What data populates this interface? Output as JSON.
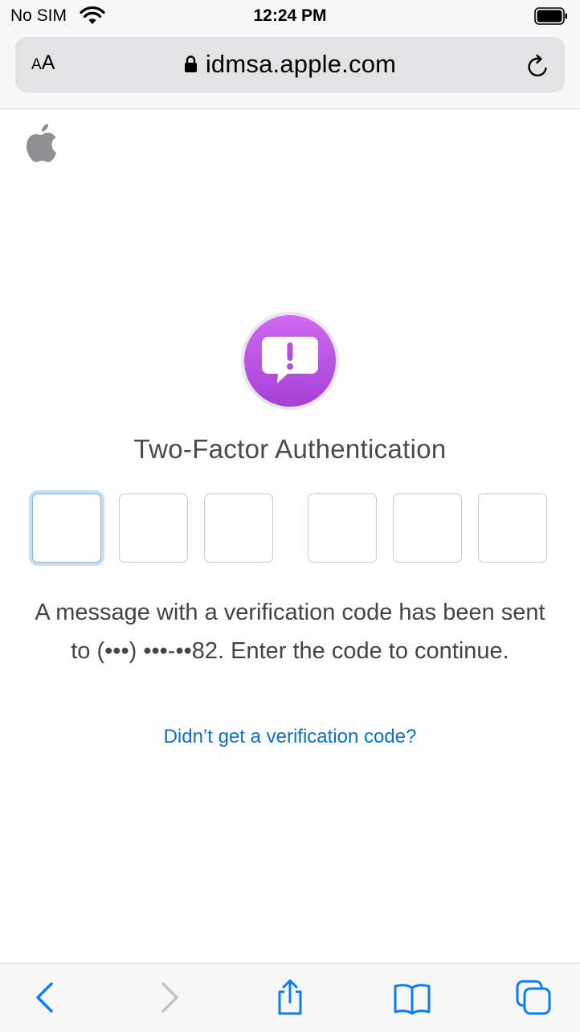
{
  "status_bar": {
    "carrier": "No SIM",
    "time": "12:24 PM"
  },
  "browser": {
    "text_size_small": "A",
    "text_size_large": "A",
    "url": "idmsa.apple.com"
  },
  "page": {
    "title": "Two-Factor Authentication",
    "code_digits": [
      "",
      "",
      "",
      "",
      "",
      ""
    ],
    "message": "A message with a verification code has been sent to (•••) •••-••82. Enter the code to continue.",
    "help_link": "Didn’t get a verification code?"
  },
  "icons": {
    "status": [
      "wifi-icon",
      "battery-icon"
    ],
    "address_bar": [
      "lock-icon",
      "reload-icon"
    ],
    "page": [
      "apple-logo-icon",
      "alert-message-icon"
    ],
    "toolbar": [
      "back-icon",
      "forward-icon",
      "share-icon",
      "bookmarks-icon",
      "tabs-icon"
    ]
  },
  "colors": {
    "link": "#0a6fcf",
    "toolbar_icon": "#0a7aff",
    "disabled_icon": "#c4c4c6",
    "badge_purple": "#b94fe0",
    "focus_ring": "#c4def4"
  }
}
